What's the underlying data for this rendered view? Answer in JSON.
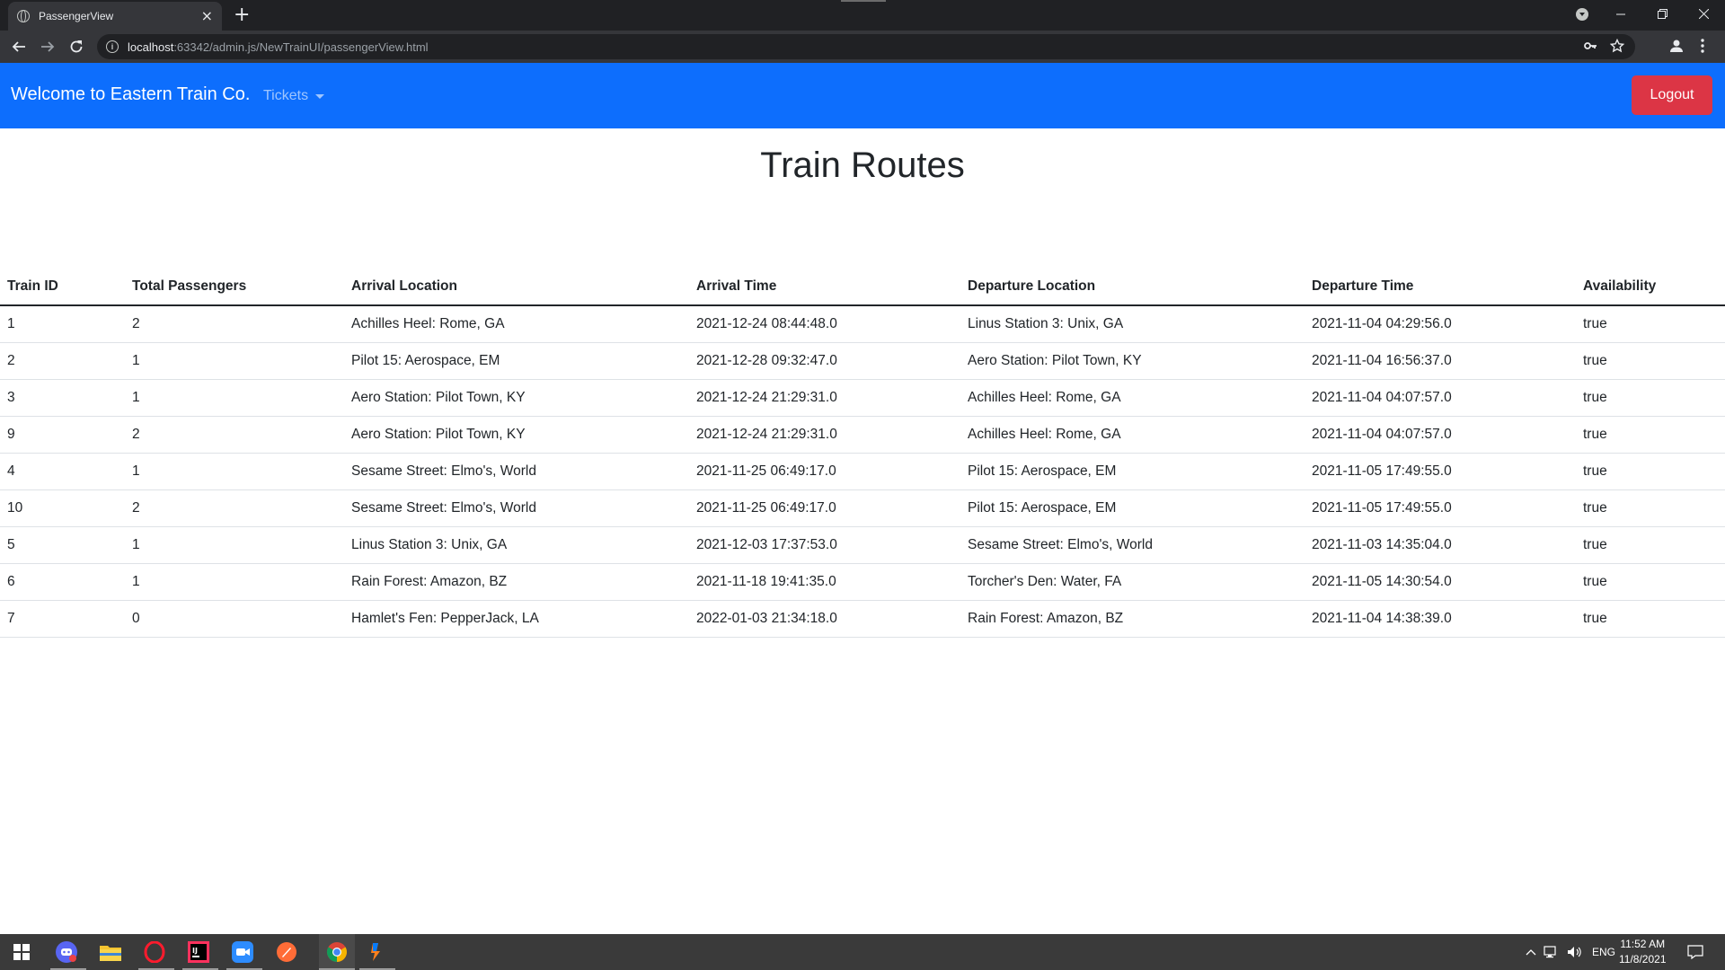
{
  "browser": {
    "tab_title": "PassengerView",
    "tab_close": "×",
    "new_tab": "+",
    "url_host": "localhost",
    "url_path": ":63342/admin.js/NewTrainUI/passengerView.html",
    "info": "i"
  },
  "navbar": {
    "brand": "Welcome to Eastern Train Co.",
    "tickets_label": "Tickets",
    "logout_label": "Logout"
  },
  "page": {
    "title": "Train Routes"
  },
  "table": {
    "headers": [
      "Train ID",
      "Total Passengers",
      "Arrival Location",
      "Arrival Time",
      "Departure Location",
      "Departure Time",
      "Availability"
    ],
    "rows": [
      [
        "1",
        "2",
        "Achilles Heel: Rome, GA",
        "2021-12-24 08:44:48.0",
        "Linus Station 3: Unix, GA",
        "2021-11-04 04:29:56.0",
        "true"
      ],
      [
        "2",
        "1",
        "Pilot 15: Aerospace, EM",
        "2021-12-28 09:32:47.0",
        "Aero Station: Pilot Town, KY",
        "2021-11-04 16:56:37.0",
        "true"
      ],
      [
        "3",
        "1",
        "Aero Station: Pilot Town, KY",
        "2021-12-24 21:29:31.0",
        "Achilles Heel: Rome, GA",
        "2021-11-04 04:07:57.0",
        "true"
      ],
      [
        "9",
        "2",
        "Aero Station: Pilot Town, KY",
        "2021-12-24 21:29:31.0",
        "Achilles Heel: Rome, GA",
        "2021-11-04 04:07:57.0",
        "true"
      ],
      [
        "4",
        "1",
        "Sesame Street: Elmo's, World",
        "2021-11-25 06:49:17.0",
        "Pilot 15: Aerospace, EM",
        "2021-11-05 17:49:55.0",
        "true"
      ],
      [
        "10",
        "2",
        "Sesame Street: Elmo's, World",
        "2021-11-25 06:49:17.0",
        "Pilot 15: Aerospace, EM",
        "2021-11-05 17:49:55.0",
        "true"
      ],
      [
        "5",
        "1",
        "Linus Station 3: Unix, GA",
        "2021-12-03 17:37:53.0",
        "Sesame Street: Elmo's, World",
        "2021-11-03 14:35:04.0",
        "true"
      ],
      [
        "6",
        "1",
        "Rain Forest: Amazon, BZ",
        "2021-11-18 19:41:35.0",
        "Torcher's Den: Water, FA",
        "2021-11-05 14:30:54.0",
        "true"
      ],
      [
        "7",
        "0",
        "Hamlet's Fen: PepperJack, LA",
        "2022-01-03 21:34:18.0",
        "Rain Forest: Amazon, BZ",
        "2021-11-04 14:38:39.0",
        "true"
      ]
    ]
  },
  "taskbar": {
    "language": "ENG",
    "time": "11:52 AM",
    "date": "11/8/2021"
  },
  "colors": {
    "navbar": "#0d6efd",
    "logout": "#dc3545",
    "chrome_dark": "#202124",
    "chrome_toolbar": "#35363a",
    "taskbar": "#3a3a3a"
  }
}
